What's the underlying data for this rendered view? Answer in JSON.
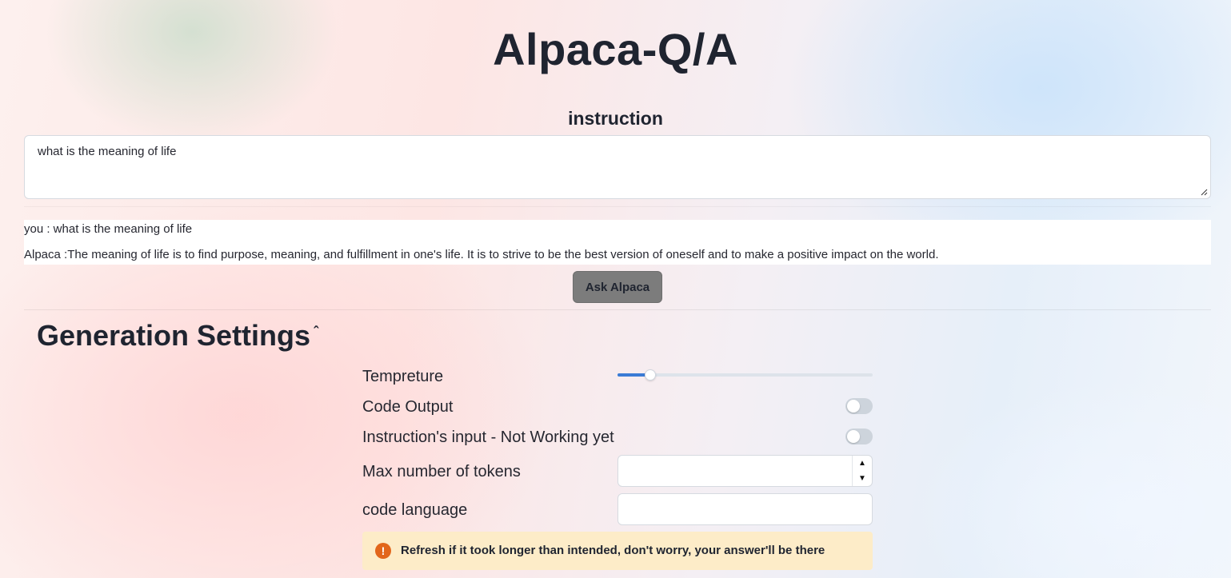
{
  "header": {
    "title": "Alpaca-Q/A"
  },
  "instruction": {
    "label": "instruction",
    "value": "what is the meaning of life"
  },
  "chat": {
    "user_line": "you : what is the meaning of life",
    "bot_line": "Alpaca :The meaning of life is to find purpose, meaning, and fulfillment in one's life. It is to strive to be the best version of oneself and to make a positive impact on the world."
  },
  "ask_button": {
    "label": "Ask Alpaca"
  },
  "settings": {
    "title": "Generation Settings",
    "caret_icon": "chevron-up-icon",
    "temperature": {
      "label": "Tempreture",
      "fraction": 0.13
    },
    "code_output": {
      "label": "Code Output",
      "checked": false
    },
    "instruction_input": {
      "label": "Instruction's input - Not Working yet",
      "checked": false
    },
    "max_tokens": {
      "label": "Max number of tokens",
      "value": ""
    },
    "code_language": {
      "label": "code language",
      "value": ""
    },
    "alert": {
      "icon": "exclamation-icon",
      "text": "Refresh if it took longer than intended, don't worry, your answer'll be there"
    }
  },
  "colors": {
    "accent": "#3a7bd5",
    "button_bg": "#7c7c7c",
    "alert_bg": "#fdecc8",
    "alert_icon": "#e2661b",
    "toggle_off": "#cdd4dc"
  }
}
